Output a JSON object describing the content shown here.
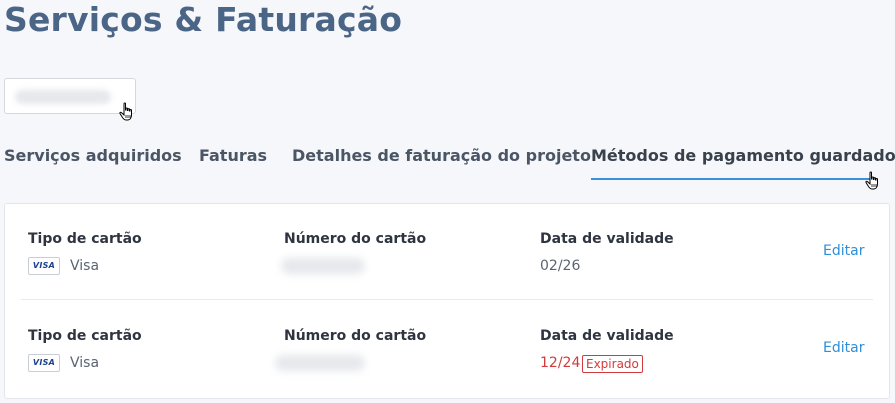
{
  "page": {
    "title": "Serviços & Faturação"
  },
  "tabs": [
    {
      "label": "Serviços adquiridos"
    },
    {
      "label": "Faturas"
    },
    {
      "label": "Detalhes de faturação do projeto"
    },
    {
      "label": "Métodos de pagamento guardados",
      "active": true
    }
  ],
  "payment_methods": {
    "labels": {
      "card_type": "Tipo de cartão",
      "card_number": "Número do cartão",
      "expiry": "Data de validade",
      "edit": "Editar"
    },
    "cards": [
      {
        "brand_badge": "VISA",
        "brand": "Visa",
        "expiry": "02/26",
        "expired": false
      },
      {
        "brand_badge": "VISA",
        "brand": "Visa",
        "expiry": "12/24",
        "expired": true,
        "status_label": "Expirado"
      }
    ]
  },
  "colors": {
    "accent": "#3c8fd9",
    "title": "#4b6587",
    "link": "#2f8fd8",
    "error": "#d23b3b"
  },
  "icons": {
    "cursor": "hand-pointer-icon",
    "card_brand": "visa-logo-icon"
  }
}
